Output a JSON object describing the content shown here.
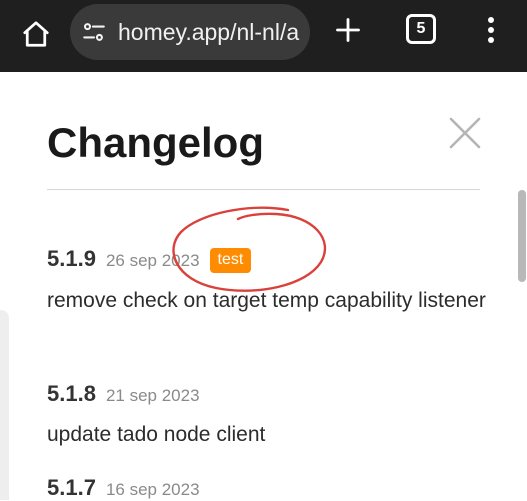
{
  "browser": {
    "url": "homey.app/nl-nl/a",
    "tab_count": "5",
    "icons": [
      "home-icon",
      "site-settings-icon",
      "plus-icon",
      "tab-switcher-icon",
      "more-vert-icon"
    ]
  },
  "page": {
    "title": "Changelog",
    "close_icon": "close-icon"
  },
  "changelog": {
    "entries": [
      {
        "version": "5.1.9",
        "date": "26 sep 2023",
        "tag": "test",
        "description": "remove check on target temp capability listener"
      },
      {
        "version": "5.1.8",
        "date": "21 sep 2023",
        "description": "update tado node client"
      },
      {
        "version": "5.1.7",
        "date": "16 sep 2023"
      }
    ]
  },
  "colors": {
    "browser_bar": "#1f1f1f",
    "url_pill": "#3a3a3a",
    "tag_background": "#ff8c00",
    "annotation_circle": "#d9413a"
  }
}
